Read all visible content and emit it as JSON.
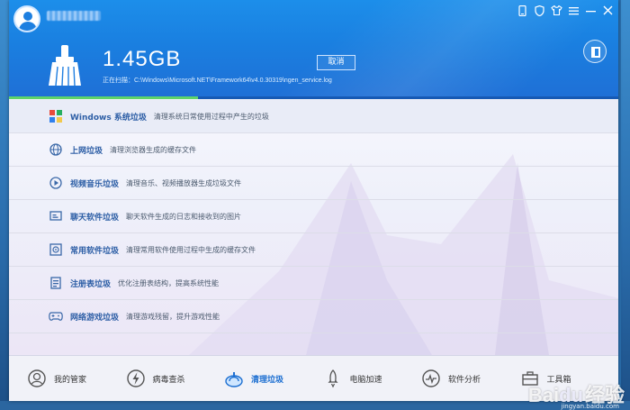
{
  "header": {
    "total_size": "1.45GB",
    "scan_path": "正在扫描：C:\\Windows\\Microsoft.NET\\Framework64\\v4.0.30319\\ngen_service.log",
    "cancel_label": "取消",
    "scan_progress": 0.31
  },
  "categories": [
    {
      "name": "Windows 系统垃圾",
      "desc": "清理系统日常使用过程中产生的垃圾",
      "icon": "windows-icon"
    },
    {
      "name": "上网垃圾",
      "desc": "清理浏览器生成的缓存文件",
      "icon": "globe-icon"
    },
    {
      "name": "视频音乐垃圾",
      "desc": "清理音乐、视频播放器生成垃圾文件",
      "icon": "play-icon"
    },
    {
      "name": "聊天软件垃圾",
      "desc": "聊天软件生成的日志和接收到的图片",
      "icon": "chat-icon"
    },
    {
      "name": "常用软件垃圾",
      "desc": "清理常用软件使用过程中生成的缓存文件",
      "icon": "disc-icon"
    },
    {
      "name": "注册表垃圾",
      "desc": "优化注册表结构，提高系统性能",
      "icon": "registry-icon"
    },
    {
      "name": "网络游戏垃圾",
      "desc": "清理游戏残留，提升游戏性能",
      "icon": "gamepad-icon"
    }
  ],
  "nav": [
    {
      "label": "我的管家",
      "icon": "butler-icon"
    },
    {
      "label": "病毒查杀",
      "icon": "virus-scan-icon"
    },
    {
      "label": "清理垃圾",
      "icon": "cleanup-icon",
      "active": true
    },
    {
      "label": "电脑加速",
      "icon": "rocket-icon"
    },
    {
      "label": "软件分析",
      "icon": "software-analysis-icon"
    },
    {
      "label": "工具箱",
      "icon": "toolbox-icon"
    }
  ],
  "colors": {
    "header_blue": "#1a7fe0",
    "progress_green": "#5fd46a",
    "link_blue": "#2e5fa6",
    "active_nav": "#1d6fd1"
  },
  "watermark": {
    "brand": "Bai",
    "mark": "du",
    "suffix": "经验",
    "url": "jingyan.baidu.com"
  }
}
